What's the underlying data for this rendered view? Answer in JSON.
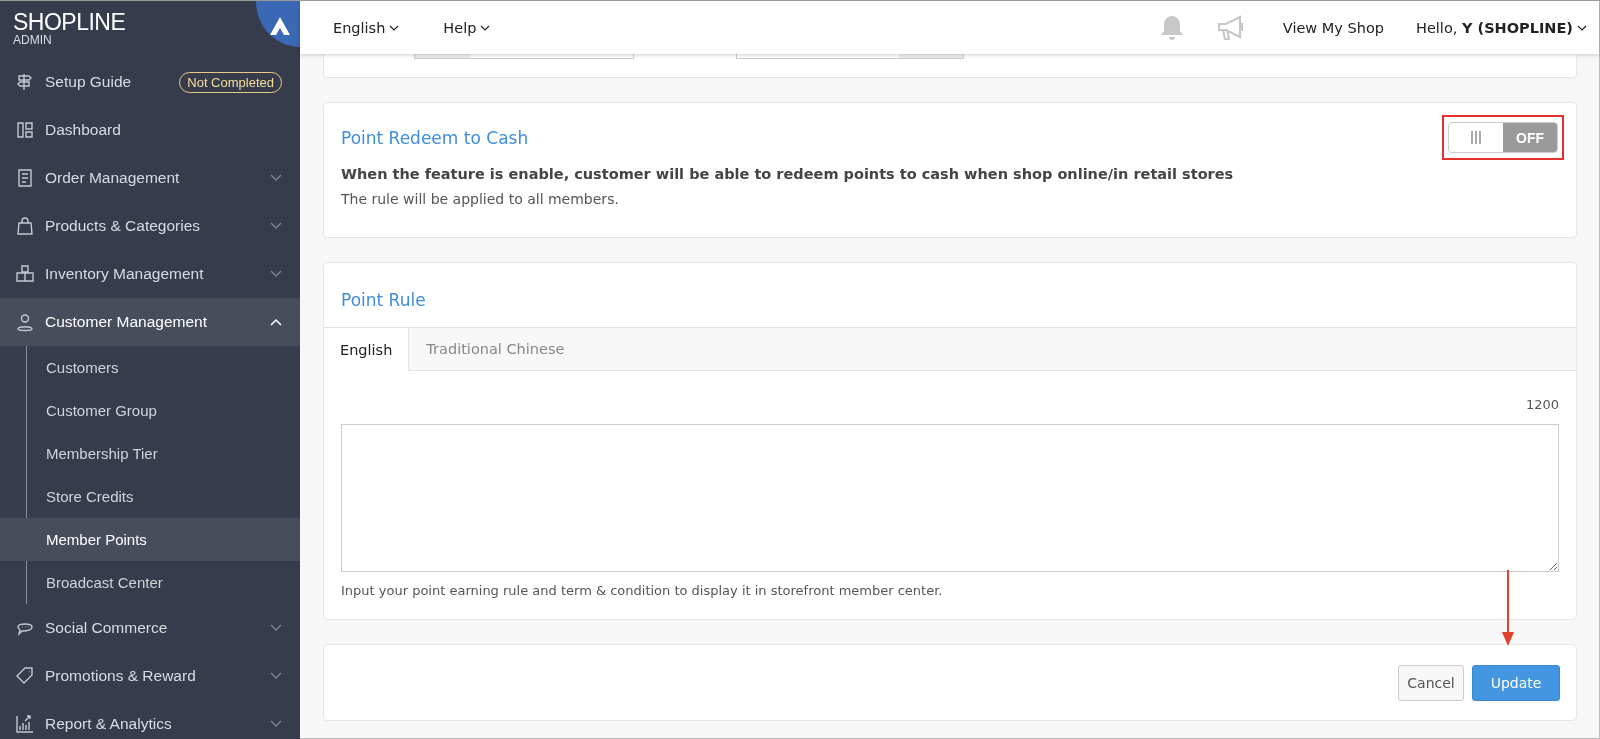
{
  "sidebar": {
    "logo": "**SHOP**LINE",
    "logo_sub": "ADMIN",
    "items": [
      {
        "label": "Setup Guide",
        "badge": "Not Completed"
      },
      {
        "label": "Dashboard"
      },
      {
        "label": "Order Management",
        "expanded": false
      },
      {
        "label": "Products & Categories",
        "expanded": false
      },
      {
        "label": "Inventory Management",
        "expanded": false
      },
      {
        "label": "Customer Management",
        "expanded": true,
        "children": [
          {
            "label": "Customers",
            "selected": false
          },
          {
            "label": "Customer Group",
            "selected": false
          },
          {
            "label": "Membership Tier",
            "selected": false
          },
          {
            "label": "Store Credits",
            "selected": false
          },
          {
            "label": "Member Points",
            "selected": true
          },
          {
            "label": "Broadcast Center",
            "selected": false
          }
        ]
      },
      {
        "label": "Social Commerce",
        "expanded": false
      },
      {
        "label": "Promotions & Reward",
        "expanded": false
      },
      {
        "label": "Report & Analytics",
        "expanded": false
      }
    ]
  },
  "topbar": {
    "menus": [
      "English",
      "Help"
    ],
    "view_shop": "View My Shop",
    "greeting": "Hello, **Y (SHOPLINE)**"
  },
  "redeem_card": {
    "title": "Point Redeem to Cash",
    "toggle": {
      "on": false,
      "label": "OFF"
    },
    "description": "When the feature is enable, customer will be able to redeem points to cash when shop online/in retail stores",
    "note": "The rule will be applied to all members."
  },
  "rule_card": {
    "title": "Point Rule",
    "tabs": [
      {
        "label": "English",
        "selected": true
      },
      {
        "label": "Traditional Chinese",
        "selected": false
      }
    ],
    "counter": "1200",
    "help": "Input your point earning rule and term & condition to display it in storefront member center."
  },
  "buttons": {
    "cancel": "Cancel",
    "update": "Update"
  }
}
